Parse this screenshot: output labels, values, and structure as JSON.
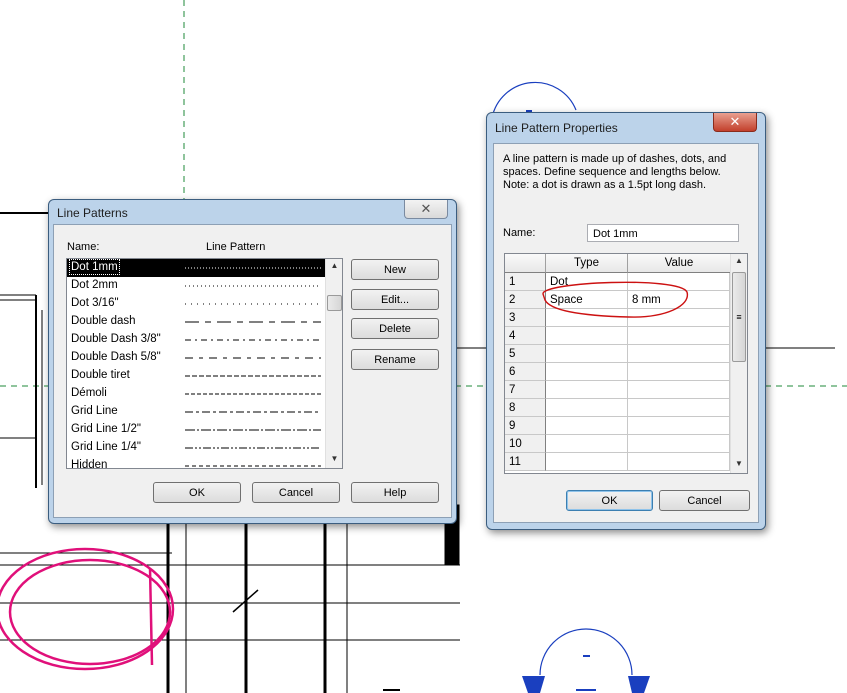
{
  "line_patterns_dialog": {
    "title": "Line Patterns",
    "close_glyph": "✕",
    "col_name": "Name:",
    "col_pattern": "Line Pattern",
    "selected_index": 0,
    "items": [
      {
        "name": "Dot 1mm",
        "dash": "1 2"
      },
      {
        "name": "Dot 2mm",
        "dash": "1 3"
      },
      {
        "name": "Dot 3/16\"",
        "dash": "1 5"
      },
      {
        "name": "Double dash",
        "dash": "14 6 6 6"
      },
      {
        "name": "Double Dash 3/8\"",
        "dash": "6 4 2 4"
      },
      {
        "name": "Double Dash 5/8\"",
        "dash": "8 6 4 6"
      },
      {
        "name": "Double tiret",
        "dash": "5 2"
      },
      {
        "name": "Démoli",
        "dash": "4 2"
      },
      {
        "name": "Grid Line",
        "dash": "8 3 3 3"
      },
      {
        "name": "Grid Line 1/2\"",
        "dash": "10 2 2 2"
      },
      {
        "name": "Grid Line 1/4\"",
        "dash": "8 2 2 2 2 2"
      },
      {
        "name": "Hidden",
        "dash": "4 3"
      }
    ],
    "buttons": {
      "new": "New",
      "edit": "Edit...",
      "delete": "Delete",
      "rename": "Rename"
    },
    "footer": {
      "ok": "OK",
      "cancel": "Cancel",
      "help": "Help"
    }
  },
  "properties_dialog": {
    "title": "Line Pattern Properties",
    "close_glyph": "✕",
    "description_lines": [
      "A line pattern is made up of dashes, dots, and",
      "spaces. Define sequence and lengths below.",
      "Note: a dot is drawn as a 1.5pt long dash."
    ],
    "name_label": "Name:",
    "name_value": "Dot 1mm",
    "columns": {
      "type": "Type",
      "value": "Value"
    },
    "rows": [
      {
        "num": "1",
        "type": "Dot",
        "value": ""
      },
      {
        "num": "2",
        "type": "Space",
        "value": "8 mm"
      },
      {
        "num": "3",
        "type": "",
        "value": ""
      },
      {
        "num": "4",
        "type": "",
        "value": ""
      },
      {
        "num": "5",
        "type": "",
        "value": ""
      },
      {
        "num": "6",
        "type": "",
        "value": ""
      },
      {
        "num": "7",
        "type": "",
        "value": ""
      },
      {
        "num": "8",
        "type": "",
        "value": ""
      },
      {
        "num": "9",
        "type": "",
        "value": ""
      },
      {
        "num": "10",
        "type": "",
        "value": ""
      },
      {
        "num": "11",
        "type": "",
        "value": ""
      }
    ],
    "footer": {
      "ok": "OK",
      "cancel": "Cancel"
    }
  },
  "colors": {
    "annotation_red": "#cc1111",
    "annotation_pink": "#e0107a",
    "grid_green": "#1f8a3a",
    "tag_blue": "#1a3fbf"
  }
}
